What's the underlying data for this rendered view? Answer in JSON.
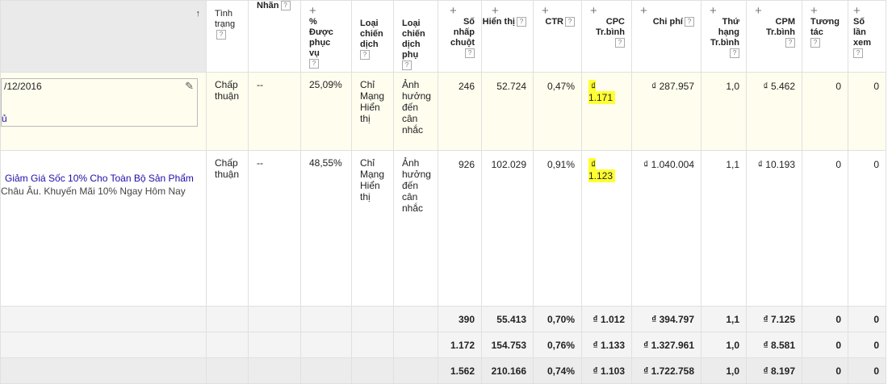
{
  "sort_indicator": "↑",
  "help_glyph": "?",
  "plus_glyph": "+",
  "headers": {
    "status": "Tình trạng",
    "labels": "Nhãn",
    "served": "% Được phục vụ",
    "campaign_type": "Loại chiến dịch",
    "campaign_subtype": "Loại chiến dịch phụ",
    "clicks": "Số nhấp chuột",
    "impressions": "Hiển thị",
    "ctr": "CTR",
    "avg_cpc": "CPC Tr.bình",
    "cost": "Chi phí",
    "avg_pos": "Thứ hạng Tr.bình",
    "avg_cpm": "CPM Tr.bình",
    "interactions": "Tương tác",
    "views": "Số lần xem"
  },
  "rows": [
    {
      "ad_date": "/12/2016",
      "ad_status_fragment": "ủ",
      "status": "Chấp thuận",
      "labels": "--",
      "served": "25,09%",
      "campaign_type": "Chỉ Mạng Hiển thị",
      "campaign_subtype": "Ảnh hưởng đến cân nhắc",
      "clicks": "246",
      "impressions": "52.724",
      "ctr": "0,47%",
      "avg_cpc": "₫ 1.171",
      "cost": "₫ 287.957",
      "avg_pos": "1,0",
      "avg_cpm": "₫ 5.462",
      "interactions": "0",
      "views": "0"
    },
    {
      "ad_title": "Giảm Giá Sốc 10% Cho Toàn Bộ Sản Phẩm",
      "ad_desc": "Châu Âu. Khuyến Mãi 10% Ngay Hôm Nay",
      "status": "Chấp thuận",
      "labels": "--",
      "served": "48,55%",
      "campaign_type": "Chỉ Mạng Hiển thị",
      "campaign_subtype": "Ảnh hưởng đến cân nhắc",
      "clicks": "926",
      "impressions": "102.029",
      "ctr": "0,91%",
      "avg_cpc": "₫ 1.123",
      "cost": "₫ 1.040.004",
      "avg_pos": "1,1",
      "avg_cpm": "₫ 10.193",
      "interactions": "0",
      "views": "0"
    }
  ],
  "totals": [
    {
      "clicks": "390",
      "impressions": "55.413",
      "ctr": "0,70%",
      "avg_cpc": "₫ 1.012",
      "cost": "₫ 394.797",
      "avg_pos": "1,1",
      "avg_cpm": "₫ 7.125",
      "interactions": "0",
      "views": "0"
    },
    {
      "clicks": "1.172",
      "impressions": "154.753",
      "ctr": "0,76%",
      "avg_cpc": "₫ 1.133",
      "cost": "₫ 1.327.961",
      "avg_pos": "1,0",
      "avg_cpm": "₫ 8.581",
      "interactions": "0",
      "views": "0"
    },
    {
      "clicks": "1.562",
      "impressions": "210.166",
      "ctr": "0,74%",
      "avg_cpc": "₫ 1.103",
      "cost": "₫ 1.722.758",
      "avg_pos": "1,0",
      "avg_cpm": "₫ 8.197",
      "interactions": "0",
      "views": "0"
    }
  ],
  "colors": {
    "highlight": "#ffff33",
    "link": "#1a0dab",
    "selected_row": "#fffdee"
  }
}
